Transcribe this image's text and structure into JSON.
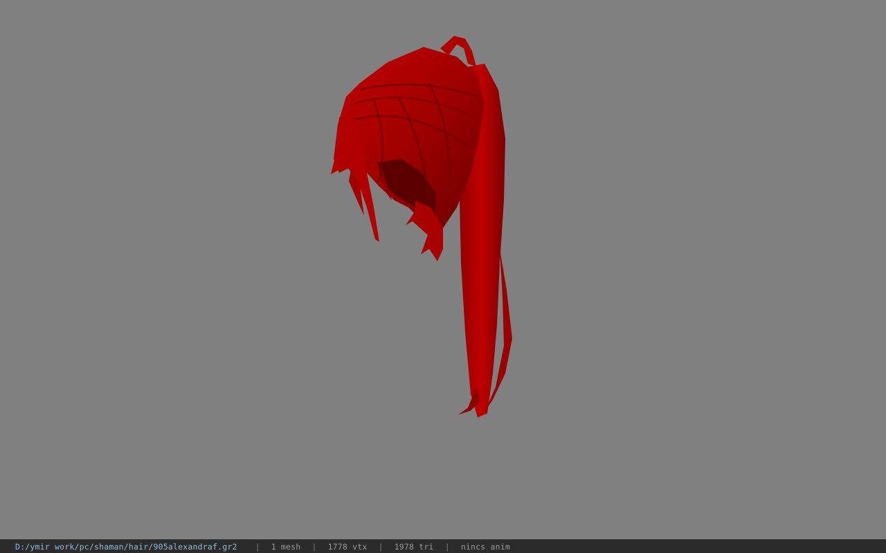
{
  "statusbar": {
    "path": "D:/ymir work/pc/shaman/hair/905alexandraf.gr2",
    "separator": "|",
    "mesh": "1 mesh",
    "vertices": "1778 vtx",
    "triangles": "1978 tri",
    "anim": "nincs anim"
  },
  "viewport": {
    "background_color": "#808080",
    "model_color": "#c00000",
    "model": "hair-mesh"
  }
}
